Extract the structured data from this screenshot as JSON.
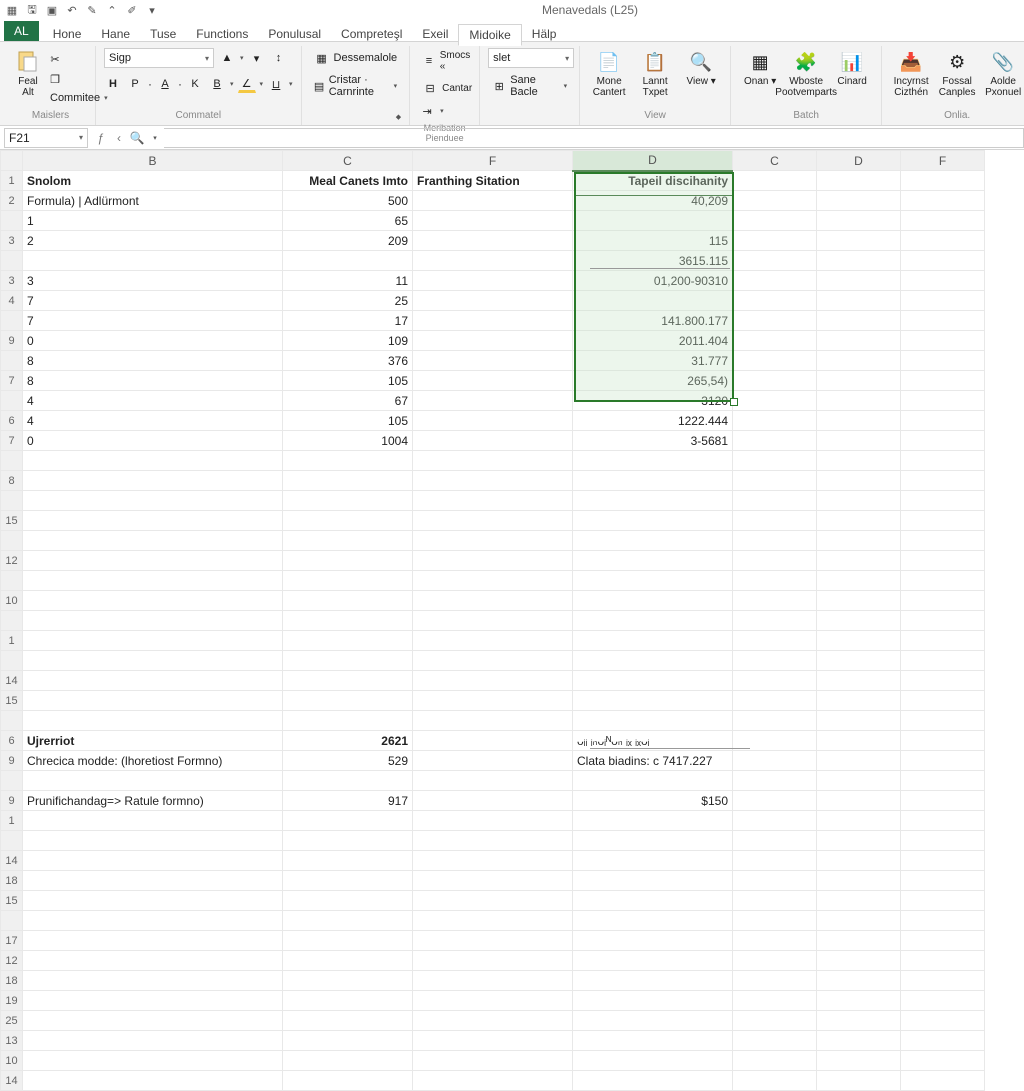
{
  "title": "Menavedals (L25)",
  "qat": [
    "excel",
    "save",
    "undo",
    "redo",
    "brush",
    "format",
    "caret"
  ],
  "tabs": {
    "file": "AL",
    "items": [
      "Hone",
      "Hane",
      "Tuse",
      "Functions",
      "Ponulusal",
      "Compreteşl",
      "Exeil",
      "Midoike",
      "Hälp"
    ],
    "active": 7
  },
  "ribbon": {
    "clipboard": {
      "paste": "Feal Alt",
      "commitee": "Commitee",
      "label": "Maislers"
    },
    "font": {
      "font_name": "Sigp",
      "bold": "H",
      "p": "P",
      "a": "A",
      "k": "K",
      "b": "B",
      "label": "Commatel"
    },
    "section3": {
      "dessemalole": "Dessemalole",
      "cristar": "Cristar · Carnrinte",
      "label": ""
    },
    "align": {
      "smocs": "Smocs «",
      "cantar": "Cantar",
      "label": "Meribation Pienduee"
    },
    "number_box": "slet",
    "sane": "Sane Bacle",
    "btns": [
      {
        "label": "Mone Cantert",
        "icon": "📄"
      },
      {
        "label": "Lannt Txpet",
        "icon": "📋"
      },
      {
        "label": "View ▾",
        "icon": "🔍"
      },
      {
        "label": "Onan ▾",
        "icon": "▦"
      },
      {
        "label": "Wboste Pootvemparts",
        "icon": "🧩"
      },
      {
        "label": "Cinard",
        "icon": "📊"
      },
      {
        "label": "Incyrnst Cizthén",
        "icon": "📥"
      },
      {
        "label": "Fossal Canples",
        "icon": "⚙"
      },
      {
        "label": "Aolde Pxonuel",
        "icon": "📎"
      }
    ],
    "group_labels": {
      "view": "View",
      "batch": "Batch",
      "onlia": "Onlia."
    }
  },
  "name_box": "F21",
  "columns": [
    "",
    "B",
    "C",
    "F",
    "D",
    "C",
    "D",
    "F"
  ],
  "rows": [
    {
      "r": "1",
      "B": "Snolom",
      "C": "Meal Canets Imto",
      "F": "Franthing Sitation",
      "D": "Tapeil discihanity",
      "boldRow": true
    },
    {
      "r": "2",
      "B": "Formula) | Adlürmont",
      "C": "500",
      "D": "40,209"
    },
    {
      "r": "",
      "B": "1",
      "C": "65",
      "D": ""
    },
    {
      "r": "3",
      "B": "2",
      "C": "209",
      "D": "115"
    },
    {
      "r": "",
      "B": "",
      "C": "",
      "D": "3615.115"
    },
    {
      "r": "3",
      "B": "3",
      "C": "11",
      "D": "01,200-90310"
    },
    {
      "r": "4",
      "B": "7",
      "C": "25",
      "D": ""
    },
    {
      "r": "",
      "B": "7",
      "C": "17",
      "D": "141.800.177"
    },
    {
      "r": "9",
      "B": "0",
      "C": "109",
      "D": "2011.404"
    },
    {
      "r": "",
      "B": "8",
      "C": "376",
      "D": "31.777"
    },
    {
      "r": "7",
      "B": "8",
      "C": "105",
      "D": "265,54)"
    },
    {
      "r": "",
      "B": "4",
      "C": "67",
      "D": "3120"
    },
    {
      "r": "6",
      "B": "4",
      "C": "105",
      "D": "1222.444"
    },
    {
      "r": "7",
      "B": "0",
      "C": "1004",
      "D": "3-5681"
    },
    {
      "r": "",
      "B": "",
      "C": "",
      "D": ""
    },
    {
      "r": "8",
      "B": "",
      "C": "",
      "D": ""
    },
    {
      "r": "",
      "B": "",
      "C": "",
      "D": ""
    },
    {
      "r": "15",
      "B": "",
      "C": "",
      "D": ""
    },
    {
      "r": "",
      "B": "",
      "C": "",
      "D": ""
    },
    {
      "r": "12",
      "B": "",
      "C": "",
      "D": ""
    },
    {
      "r": "",
      "B": "",
      "C": "",
      "D": ""
    },
    {
      "r": "10",
      "B": "",
      "C": "",
      "D": ""
    },
    {
      "r": "",
      "B": "",
      "C": "",
      "D": ""
    },
    {
      "r": "1",
      "B": "",
      "C": "",
      "D": ""
    },
    {
      "r": "",
      "B": "",
      "C": "",
      "D": ""
    },
    {
      "r": "14",
      "B": "",
      "C": "",
      "D": ""
    },
    {
      "r": "15",
      "B": "",
      "C": "",
      "D": ""
    },
    {
      "r": "",
      "B": "",
      "C": "",
      "D": ""
    },
    {
      "r": "6",
      "B": "Ujrerriot",
      "C": "2621",
      "D": "ᴗᵢᵢ ᵢₙᴗᵢᴺᴗₙ ᵢₓ ᵢₓᴗᵢ",
      "boldB": true,
      "boldC": true
    },
    {
      "r": "9",
      "B": "Chrecica modde: (lhoretiost Formno)",
      "C": "529",
      "D": "Clata biadins: c 7417.227"
    },
    {
      "r": "",
      "B": "",
      "C": "",
      "D": ""
    },
    {
      "r": "9",
      "B": "Prunifichandag=> Ratule formno)",
      "C": "917",
      "D": "$150",
      "rightD": true
    },
    {
      "r": "1",
      "B": "",
      "C": "",
      "D": ""
    },
    {
      "r": "",
      "B": "",
      "C": "",
      "D": ""
    },
    {
      "r": "14",
      "B": "",
      "C": "",
      "D": ""
    },
    {
      "r": "18",
      "B": "",
      "C": "",
      "D": ""
    },
    {
      "r": "15",
      "B": "",
      "C": "",
      "D": ""
    },
    {
      "r": "",
      "B": "",
      "C": "",
      "D": ""
    },
    {
      "r": "17",
      "B": "",
      "C": "",
      "D": ""
    },
    {
      "r": "12",
      "B": "",
      "C": "",
      "D": ""
    },
    {
      "r": "18",
      "B": "",
      "C": "",
      "D": ""
    },
    {
      "r": "19",
      "B": "",
      "C": "",
      "D": ""
    },
    {
      "r": "25",
      "B": "",
      "C": "",
      "D": ""
    },
    {
      "r": "13",
      "B": "",
      "C": "",
      "D": ""
    },
    {
      "r": "10",
      "B": "",
      "C": "",
      "D": ""
    },
    {
      "r": "14",
      "B": "",
      "C": "",
      "D": ""
    }
  ]
}
